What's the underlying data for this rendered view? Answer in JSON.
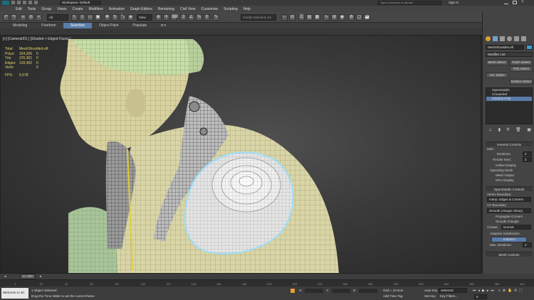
{
  "title": {
    "workspace": "Workspace: Default",
    "search_placeholder": "Type a keyword or phrase",
    "sign_in": "Sign In"
  },
  "menu": [
    "Edit",
    "Tools",
    "Group",
    "Views",
    "Create",
    "Modifiers",
    "Animation",
    "Graph Editors",
    "Rendering",
    "Civil View",
    "Customize",
    "Scripting",
    "Help"
  ],
  "ribbon_tabs": [
    {
      "label": "Modeling",
      "active": false
    },
    {
      "label": "Freeform",
      "active": false
    },
    {
      "label": "Selection",
      "active": true
    },
    {
      "label": "Object Paint",
      "active": false
    },
    {
      "label": "Populate",
      "active": false
    }
  ],
  "toolbar": {
    "filter": "All",
    "view": "View",
    "selection_set": "Create Selection Se"
  },
  "viewport": {
    "label": "[+] [Camera001 ] [Shaded + Edged Faces ]",
    "stats": {
      "header": {
        "k": "Total",
        "c1": "MeshShoulderLeft",
        "c2": ""
      },
      "rows": [
        {
          "k": "Polys:",
          "c1": "324,306",
          "c2": "0"
        },
        {
          "k": "Tris:",
          "c1": "376,301",
          "c2": "0"
        },
        {
          "k": "Edges:",
          "c1": "133,492",
          "c2": "0"
        },
        {
          "k": "Verts:",
          "c1": "",
          "c2": "0"
        }
      ],
      "fps_label": "FPS:",
      "fps_value": "5.678"
    }
  },
  "panel": {
    "object_name": "MeshShoulderLeft",
    "modifier_list": "Modifier List",
    "buttons": [
      "Mesh Select",
      "Patch Select",
      "Vol. Select",
      "Poly Select",
      "Surface Select"
    ],
    "stack": [
      "OpenSubdiv",
      "CreaseSet",
      "Editable Poly"
    ],
    "general_controls": "General Controls",
    "main": "Main",
    "iterations_label": "Iterations:",
    "iterations": "2",
    "render_iters_label": "Render Iters:",
    "render_iters": "2",
    "isoline_display": "Isoline Display",
    "operating_mode": "Operating Mode",
    "mesh_output": "Mesh Output",
    "gpu_display": "GPU Display",
    "osd_controls": "OpenSubdiv Controls",
    "vertex_boundary": "Vertex Boundary:",
    "vertex_boundary_val": "Interp. Edges & Corners",
    "uv_boundary": "UV Boundary:",
    "uv_boundary_val": "Smooth (Always Sharp)",
    "propagate_corners": "Propagate Corners",
    "smooth_triangle": "Smooth Triangle",
    "crease": "Crease:",
    "crease_val": "Normal",
    "adaptive": "Adaptive Subdivision",
    "adaptive_btn": "Adaptive",
    "max_iterations": "Max. Iterations:",
    "max_iterations_val": "3",
    "mesh_controls": "Mesh Controls"
  },
  "timeline": {
    "frame": "0 / 400",
    "ticks": [
      "0",
      "20",
      "40",
      "60",
      "80",
      "100",
      "120",
      "140",
      "160",
      "180",
      "200",
      "220",
      "240",
      "260",
      "280",
      "300",
      "320",
      "340",
      "360",
      "380",
      "400"
    ]
  },
  "status": {
    "script": "Welcome to 3C",
    "selected": "1 Object Selected",
    "prompt": "Drag the Time Slider to set the current frame",
    "x": "X:",
    "y": "Y:",
    "z": "Z:",
    "grid": "Grid = 10.0cm",
    "add_time_tag": "Add Time Tag",
    "auto_key": "Auto Key",
    "set_key": "Set Key",
    "key_mode": "Selected",
    "key_filters": "Key Filters...",
    "frame": "0"
  },
  "colors": {
    "accent": "#5a7ca8",
    "stats_yellow": "#e6d66a",
    "viewport_bg": "#3a3a3a"
  }
}
